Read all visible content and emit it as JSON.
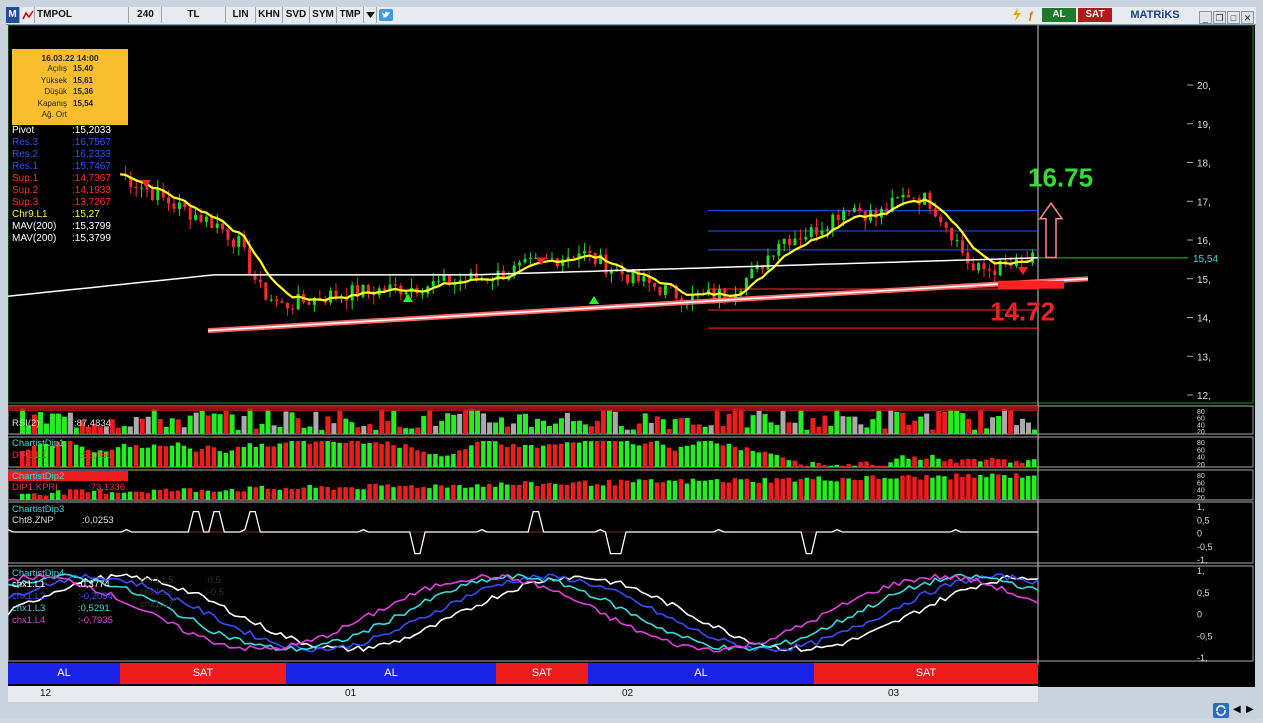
{
  "toolbar": {
    "m_label": "M",
    "symbol": "TMPOL",
    "items": [
      "240",
      "TL",
      "LIN",
      "KHN",
      "SVD",
      "SYM",
      "TMP"
    ],
    "buy_label": "AL",
    "sell_label": "SAT",
    "brand": "MATRiKS"
  },
  "info_box": {
    "datetime": "16.03.22 14:00",
    "rows": [
      {
        "k": "Açılış",
        "v": "15,40"
      },
      {
        "k": "Yüksek",
        "v": "15,61"
      },
      {
        "k": "Düşük",
        "v": "15,36"
      },
      {
        "k": "Kapanış",
        "v": "15,54"
      },
      {
        "k": "Ağ. Ort",
        "v": ""
      }
    ]
  },
  "levels": [
    {
      "name": "Pivot",
      "value": ":15,2033",
      "color": "#ffffff"
    },
    {
      "name": "Res.3",
      "value": ":16,7567",
      "color": "#2a56ff"
    },
    {
      "name": "Res.2",
      "value": ":16,2333",
      "color": "#2a56ff"
    },
    {
      "name": "Res.1",
      "value": ":15,7467",
      "color": "#2a56ff"
    },
    {
      "name": "Sup.1",
      "value": ":14,7367",
      "color": "#ff2a2a"
    },
    {
      "name": "Sup.2",
      "value": ":14,1933",
      "color": "#ff2a2a"
    },
    {
      "name": "Sup.3",
      "value": ":13,7267",
      "color": "#ff2a2a"
    },
    {
      "name": "Chr9.L1",
      "value": ":15,27",
      "color": "#ffff33"
    },
    {
      "name": "MAV(200)",
      "value": ":15,3799",
      "color": "#ffffff"
    },
    {
      "name": "MAV(200)",
      "value": ":15,3799",
      "color": "#ffffff"
    }
  ],
  "annotations": {
    "target_up": "16.75",
    "target_down": "14.72",
    "last_price": "15,54"
  },
  "price_axis": [
    "20,",
    "19,",
    "18,",
    "17,",
    "16,",
    "15,",
    "14,",
    "13,",
    "12,"
  ],
  "panels": {
    "rsi": {
      "label": "RSI(2)",
      "value": ":87,4834",
      "ticks": [
        "80",
        "60",
        "40",
        "20"
      ]
    },
    "dip1": {
      "title": "ChartistDip1",
      "label": "DIP2.L1",
      "value": ":55,056",
      "ticks": [
        "80",
        "60",
        "40",
        "20"
      ]
    },
    "dip2": {
      "title": "ChartistDip2",
      "label": "DIP1.KPRI",
      "value": ":73,1336",
      "ticks": [
        "80",
        "60",
        "40",
        "20"
      ]
    },
    "dip3": {
      "title": "ChartistDip3",
      "label": "Cht8.ZNP",
      "value": ":0,0253",
      "ticks": [
        "1,",
        "0,5",
        "0",
        "-0,5",
        "-1,"
      ]
    },
    "chx": {
      "title": "ChartistDip4",
      "labels": [
        {
          "name": "chx1.L1",
          "value": ":0,3774",
          "color": "#ffffff"
        },
        {
          "name": "chx1.L2",
          "value": ":-0,2034",
          "color": "#3a4cff"
        },
        {
          "name": "chx1.L3",
          "value": ":0,5291",
          "color": "#33dddd"
        },
        {
          "name": "chx1.L4",
          "value": ":-0,7935",
          "color": "#e040e0"
        }
      ],
      "ghost": [
        {
          "name": "chx1.L5",
          "value": ":0,5"
        },
        {
          "name": "chx1.L6",
          "value": ":-0,5"
        },
        {
          "name": "chx1.L7",
          "value": ""
        }
      ],
      "ticks": [
        "1,",
        "0,5",
        "0",
        "-0,5",
        "-1,"
      ]
    }
  },
  "signals": [
    {
      "label": "AL",
      "color": "#1a22e8",
      "w": 112
    },
    {
      "label": "SAT",
      "color": "#ee1c1c",
      "w": 166
    },
    {
      "label": "AL",
      "color": "#1a22e8",
      "w": 210
    },
    {
      "label": "SAT",
      "color": "#ee1c1c",
      "w": 92
    },
    {
      "label": "AL",
      "color": "#1a22e8",
      "w": 226
    },
    {
      "label": "SAT",
      "color": "#ee1c1c",
      "w": 224
    }
  ],
  "dates": [
    {
      "label": "12"
    },
    {
      "label": "01"
    },
    {
      "label": "02"
    },
    {
      "label": "03"
    }
  ]
}
